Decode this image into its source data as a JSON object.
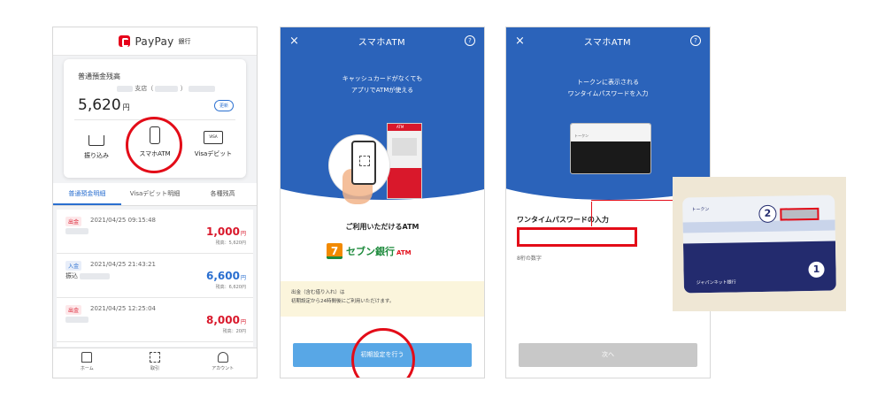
{
  "screen1": {
    "app_name": "PayPay",
    "app_sub": "銀行",
    "account_type": "普通預金残高",
    "branch_label": "支店（",
    "branch_close": "）",
    "balance": "5,620",
    "balance_unit": "円",
    "detail_label": "更新",
    "actions": [
      {
        "label": "振り込み",
        "icon": "transfer-icon"
      },
      {
        "label": "スマホATM",
        "icon": "phone-icon"
      },
      {
        "label": "Visaデビット",
        "icon": "visa-card-icon",
        "badge": "VISA"
      }
    ],
    "tabs": [
      "普通預金明細",
      "Visaデビット明細",
      "各種残高"
    ],
    "transactions": [
      {
        "type": "出金",
        "date": "2021/04/25 09:15:48",
        "desc": "",
        "amount": "1,000",
        "unit": "円",
        "balance": "残高：5,620円",
        "dir": "out"
      },
      {
        "type": "入金",
        "date": "2021/04/25 21:43:21",
        "desc": "振込",
        "amount": "6,600",
        "unit": "円",
        "balance": "残高：6,620円",
        "dir": "in"
      },
      {
        "type": "出金",
        "date": "2021/04/25 12:25:04",
        "desc": "",
        "amount": "8,000",
        "unit": "円",
        "balance": "残高：20円",
        "dir": "out"
      }
    ],
    "nav": [
      {
        "label": "ホーム",
        "icon": "home-icon"
      },
      {
        "label": "取引",
        "icon": "grid-icon"
      },
      {
        "label": "アカウント",
        "icon": "user-icon"
      }
    ]
  },
  "screen2": {
    "close": "×",
    "title": "スマホATM",
    "help": "?",
    "headline_1": "キャッシュカードがなくても",
    "headline_2": "アプリでATMが使える",
    "atm_sign": "ATM",
    "available_heading": "ご利用いただけるATM",
    "seven_mark": "7",
    "seven_name": "セブン銀行",
    "seven_atm": "ATM",
    "notice_1": "出金（含む借り入れ）は",
    "notice_2": "初期設定から24時間後にご利用いただけます。",
    "button": "初期設定を行う"
  },
  "screen3": {
    "close": "×",
    "title": "スマホATM",
    "help": "?",
    "headline_1": "トークンに表示される",
    "headline_2": "ワンタイムパスワードを入力",
    "card_text": "トークン",
    "otp_label": "ワンタイムパスワードの入力",
    "otp_hint": "8桁の数字",
    "button": "次へ"
  },
  "token_photo": {
    "card_label": "トークン",
    "num_2": "2",
    "num_1": "1",
    "brand": "ジャパンネット銀行"
  },
  "colors": {
    "accent_blue": "#2b63ba",
    "highlight_red": "#e30c18",
    "button_blue": "#58a7e6"
  }
}
